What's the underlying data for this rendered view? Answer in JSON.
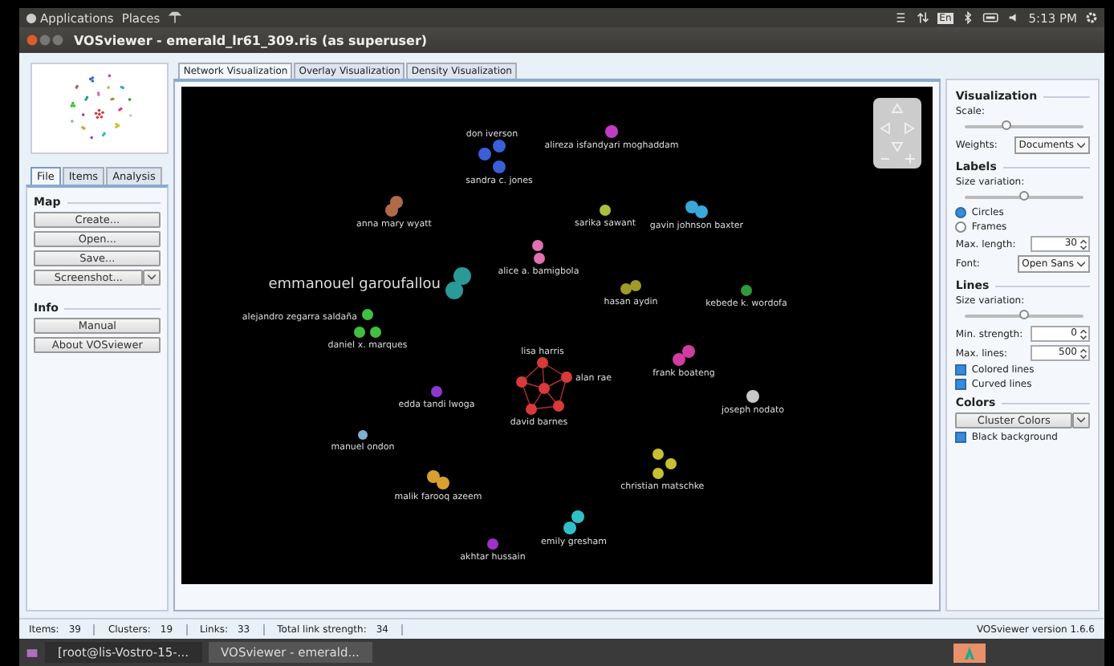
{
  "top_panel": {
    "menus": [
      "Applications",
      "Places"
    ],
    "keyboard_layout": "En",
    "clock": "5:13 PM"
  },
  "window": {
    "title": "VOSviewer - emerald_lr61_309.ris (as superuser)"
  },
  "left_panel": {
    "tabs": [
      {
        "label": "File",
        "selected": true
      },
      {
        "label": "Items",
        "selected": false
      },
      {
        "label": "Analysis",
        "selected": false
      }
    ],
    "map_heading": "Map",
    "map_buttons": [
      "Create...",
      "Open...",
      "Save..."
    ],
    "screenshot_button": "Screenshot...",
    "info_heading": "Info",
    "info_buttons": [
      "Manual",
      "About VOSviewer"
    ]
  },
  "view_tabs": [
    {
      "label": "Network Visualization",
      "selected": true
    },
    {
      "label": "Overlay Visualization",
      "selected": false
    },
    {
      "label": "Density Visualization",
      "selected": false
    }
  ],
  "network": {
    "nodes": [
      {
        "label": "alireza isfandyari moghaddam",
        "color": "#c03cc8"
      },
      {
        "label": "don iverson",
        "color": "#3a5fd8"
      },
      {
        "label": "sandra c. jones",
        "color": "#3a5fd8"
      },
      {
        "label": "anna mary wyatt",
        "color": "#b06a48"
      },
      {
        "label": "sarika sawant",
        "color": "#a8c040"
      },
      {
        "label": "gavin johnson baxter",
        "color": "#3aa8d8"
      },
      {
        "label": "alice a. bamigbola",
        "color": "#e070b0"
      },
      {
        "label": "emmanouel garoufallou",
        "color": "#2a9a98"
      },
      {
        "label": "hasan aydin",
        "color": "#a09a28"
      },
      {
        "label": "kebede k. wordofa",
        "color": "#2e9a38"
      },
      {
        "label": "alejandro zegarra saldaña",
        "color": "#40c040"
      },
      {
        "label": "daniel x. marques",
        "color": "#40c040"
      },
      {
        "label": "frank boateng",
        "color": "#d03ca0"
      },
      {
        "label": "lisa harris",
        "color": "#d83a3a"
      },
      {
        "label": "alan rae",
        "color": "#d83a3a"
      },
      {
        "label": "david barnes",
        "color": "#d83a3a"
      },
      {
        "label": "edda tandi lwoga",
        "color": "#8a3ad0"
      },
      {
        "label": "joseph nodato",
        "color": "#c8c8c8"
      },
      {
        "label": "manuel ondon",
        "color": "#80b0d0"
      },
      {
        "label": "christian matschke",
        "color": "#c8c030"
      },
      {
        "label": "malik farooq azeem",
        "color": "#d8a030"
      },
      {
        "label": "emily gresham",
        "color": "#30c0c8"
      },
      {
        "label": "akhtar hussain",
        "color": "#a030c8"
      }
    ]
  },
  "right_panel": {
    "visualization": {
      "heading": "Visualization",
      "scale_label": "Scale:",
      "scale": {
        "level": 0.35
      },
      "weights_label": "Weights:",
      "weights": "Documents"
    },
    "labels": {
      "heading": "Labels",
      "size_label": "Size variation:",
      "size": {
        "level": 0.5
      },
      "shapes": [
        {
          "label": "Circles",
          "selected": true
        },
        {
          "label": "Frames",
          "selected": false
        }
      ],
      "max_length_label": "Max. length:",
      "max_length": "30",
      "font_label": "Font:",
      "font": "Open Sans"
    },
    "lines": {
      "heading": "Lines",
      "size_label": "Size variation:",
      "size": {
        "level": 0.5
      },
      "min_strength_label": "Min. strength:",
      "min_strength": "0",
      "max_lines_label": "Max. lines:",
      "max_lines": "500",
      "options": [
        {
          "label": "Colored lines",
          "checked": true
        },
        {
          "label": "Curved lines",
          "checked": true
        }
      ]
    },
    "colors": {
      "heading": "Colors",
      "scheme": "Cluster Colors",
      "black_background": {
        "label": "Black background",
        "checked": true
      }
    }
  },
  "status_bar": {
    "stats": [
      {
        "label": "Items:",
        "value": "39"
      },
      {
        "label": "Clusters:",
        "value": "19"
      },
      {
        "label": "Links:",
        "value": "33"
      },
      {
        "label": "Total link strength:",
        "value": "34"
      }
    ],
    "version": "VOSviewer version 1.6.6"
  },
  "taskbar": {
    "items": [
      {
        "label": "[root@lis-Vostro-15-...",
        "selected": false
      },
      {
        "label": "VOSviewer - emerald...",
        "selected": true
      }
    ]
  }
}
